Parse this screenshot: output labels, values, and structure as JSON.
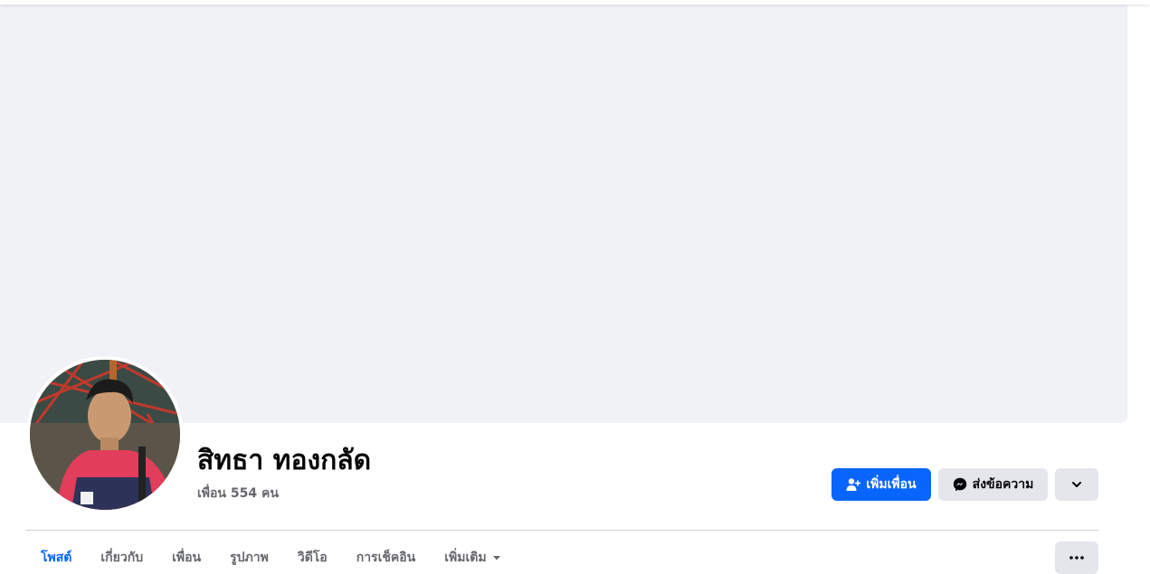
{
  "profile": {
    "name": "สิทธา ทองกลัด",
    "friends_count": "เพื่อน 554 คน"
  },
  "actions": {
    "add_friend_label": "เพิ่มเพื่อน",
    "message_label": "ส่งข้อความ",
    "add_friend_icon": "person-add-icon",
    "message_icon": "messenger-icon",
    "more_icon": "chevron-down-icon"
  },
  "tabs": [
    {
      "label": "โพสต์",
      "active": true
    },
    {
      "label": "เกี่ยวกับ",
      "active": false
    },
    {
      "label": "เพื่อน",
      "active": false
    },
    {
      "label": "รูปภาพ",
      "active": false
    },
    {
      "label": "วิดีโอ",
      "active": false
    },
    {
      "label": "การเช็คอิน",
      "active": false
    },
    {
      "label": "เพิ่มเติม",
      "active": false
    }
  ],
  "colors": {
    "accent": "#0866ff",
    "secondary_button": "#e4e6eb",
    "cover": "#f0f2f5",
    "muted_text": "#65676b"
  }
}
